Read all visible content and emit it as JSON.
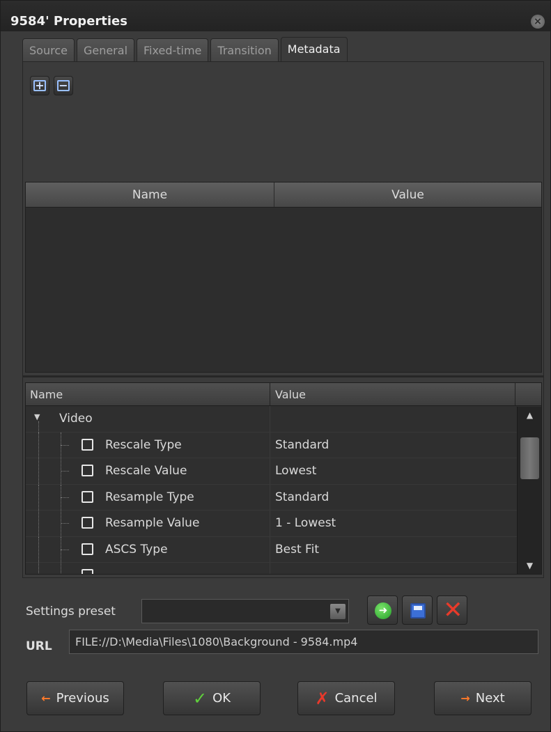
{
  "window": {
    "title": "9584' Properties",
    "close_icon": "close-circle-icon"
  },
  "tabs": [
    {
      "label": "Source",
      "active": false
    },
    {
      "label": "General",
      "active": false
    },
    {
      "label": "Fixed-time",
      "active": false
    },
    {
      "label": "Transition",
      "active": false
    },
    {
      "label": "Metadata",
      "active": true
    }
  ],
  "toolbar": {
    "add_label": "+",
    "remove_label": "−"
  },
  "metadata_table": {
    "columns": [
      "Name",
      "Value"
    ],
    "rows": []
  },
  "properties_table": {
    "columns": [
      "Name",
      "Value"
    ],
    "group": "Video",
    "rows": [
      {
        "name": "Rescale Type",
        "value": "Standard"
      },
      {
        "name": "Rescale Value",
        "value": "Lowest"
      },
      {
        "name": "Resample Type",
        "value": "Standard"
      },
      {
        "name": "Resample Value",
        "value": "1 - Lowest"
      },
      {
        "name": "ASCS Type",
        "value": "Best Fit"
      }
    ]
  },
  "settings": {
    "preset_label": "Settings preset",
    "preset_value": "",
    "url_label": "URL",
    "url_value": "FILE://D:\\Media\\Files\\1080\\Background - 9584.mp4"
  },
  "buttons": {
    "previous": "Previous",
    "ok": "OK",
    "cancel": "Cancel",
    "next": "Next"
  },
  "colors": {
    "background": "#3b3b3b",
    "accent_green": "#5fd03c",
    "accent_red": "#e8392b",
    "accent_orange": "#ff7a2a",
    "accent_blue": "#9ac0ff"
  }
}
